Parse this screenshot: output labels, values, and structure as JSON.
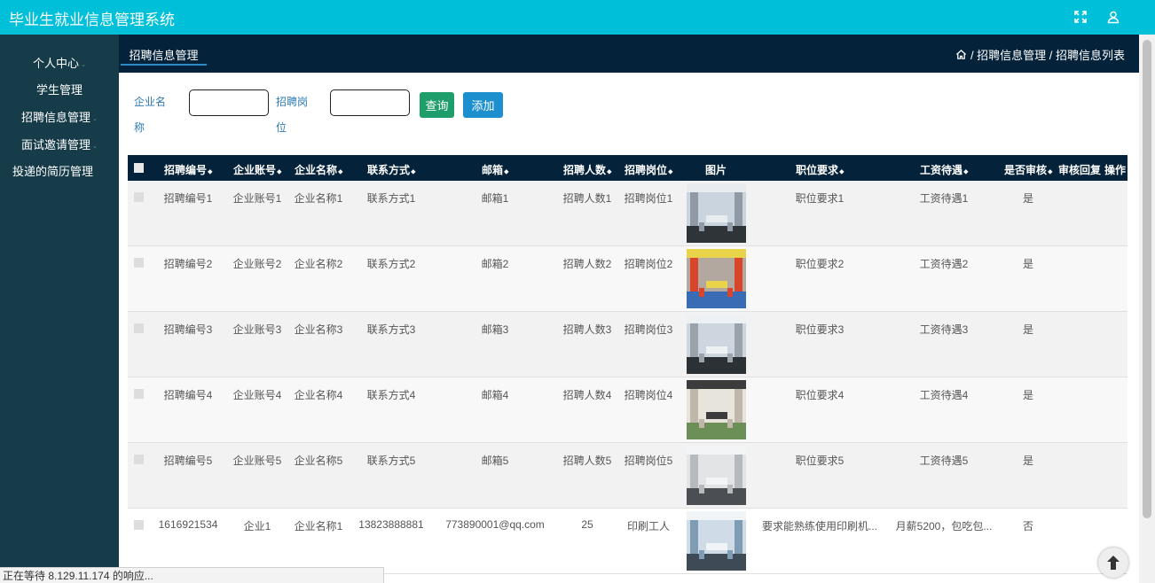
{
  "app": {
    "title": "毕业生就业信息管理系统"
  },
  "sidebar": {
    "items": [
      {
        "label": "个人中心",
        "caret": "⌄"
      },
      {
        "label": "学生管理"
      },
      {
        "label": "招聘信息管理",
        "caret": "⌄"
      },
      {
        "label": "面试邀请管理",
        "caret": "⌄"
      },
      {
        "label": "投递的简历管理"
      }
    ]
  },
  "navbar": {
    "tab": "招聘信息管理",
    "breadcrumb": "/ 招聘信息管理 / 招聘信息列表"
  },
  "search": {
    "company_label": "企业名称",
    "company_value": "",
    "position_label": "招聘岗位",
    "position_value": "",
    "query_button": "查询",
    "add_button": "添加"
  },
  "table": {
    "columns": [
      "招聘编号",
      "企业账号",
      "企业名称",
      "联系方式",
      "邮箱",
      "招聘人数",
      "招聘岗位",
      "图片",
      "职位要求",
      "工资待遇",
      "是否审核",
      "审核回复",
      "操作"
    ],
    "rows": [
      {
        "no": "招聘编号1",
        "account": "企业账号1",
        "company": "企业名称1",
        "contact": "联系方式1",
        "email": "邮箱1",
        "count": "招聘人数1",
        "position": "招聘岗位1",
        "image": "office-photo",
        "requirement": "职位要求1",
        "salary": "工资待遇1",
        "approved": "是"
      },
      {
        "no": "招聘编号2",
        "account": "企业账号2",
        "company": "企业名称2",
        "contact": "联系方式2",
        "email": "邮箱2",
        "count": "招聘人数2",
        "position": "招聘岗位2",
        "image": "office-photo",
        "requirement": "职位要求2",
        "salary": "工资待遇2",
        "approved": "是"
      },
      {
        "no": "招聘编号3",
        "account": "企业账号3",
        "company": "企业名称3",
        "contact": "联系方式3",
        "email": "邮箱3",
        "count": "招聘人数3",
        "position": "招聘岗位3",
        "image": "office-photo",
        "requirement": "职位要求3",
        "salary": "工资待遇3",
        "approved": "是"
      },
      {
        "no": "招聘编号4",
        "account": "企业账号4",
        "company": "企业名称4",
        "contact": "联系方式4",
        "email": "邮箱4",
        "count": "招聘人数4",
        "position": "招聘岗位4",
        "image": "office-photo",
        "requirement": "职位要求4",
        "salary": "工资待遇4",
        "approved": "是"
      },
      {
        "no": "招聘编号5",
        "account": "企业账号5",
        "company": "企业名称5",
        "contact": "联系方式5",
        "email": "邮箱5",
        "count": "招聘人数5",
        "position": "招聘岗位5",
        "image": "office-photo",
        "requirement": "职位要求5",
        "salary": "工资待遇5",
        "approved": "是"
      },
      {
        "no": "1616921534",
        "account": "企业1",
        "company": "企业名称1",
        "contact": "13823888881",
        "email": "773890001@qq.com",
        "count": "25",
        "position": "印刷工人",
        "image": "office-photo",
        "requirement": "要求能熟练使用印刷机...",
        "salary": "月薪5200，包吃包...",
        "approved": "否"
      }
    ]
  },
  "statusbar": {
    "text": "正在等待 8.129.11.174 的响应..."
  },
  "colors": {
    "topbar": "#00c0d9",
    "sidebar": "#173c49",
    "navbar": "#04223a",
    "query": "#1e9e6a",
    "add": "#1c8fce"
  }
}
